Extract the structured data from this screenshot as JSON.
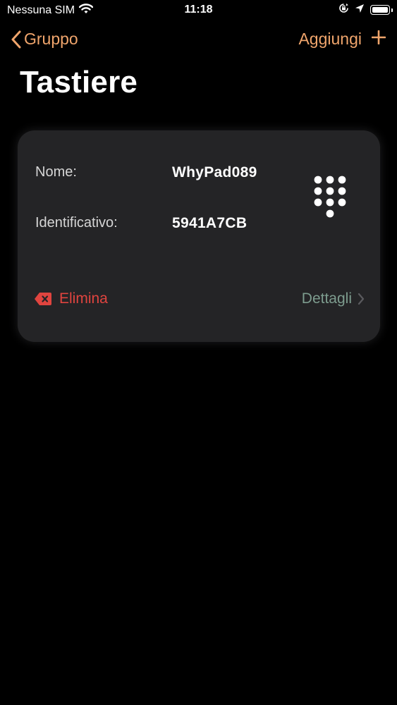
{
  "status_bar": {
    "carrier": "Nessuna SIM",
    "time": "11:18"
  },
  "nav": {
    "back_label": "Gruppo",
    "add_label": "Aggiungi"
  },
  "page": {
    "title": "Tastiere"
  },
  "card": {
    "name_label": "Nome:",
    "name_value": "WhyPad089",
    "id_label": "Identificativo:",
    "id_value": "5941A7CB",
    "delete_label": "Elimina",
    "details_label": "Dettagli",
    "icon": "keypad-icon"
  },
  "colors": {
    "accent": "#f0a56c",
    "danger": "#e0443f",
    "details": "#7d9c8e",
    "card_bg": "#242426",
    "background": "#000000"
  }
}
